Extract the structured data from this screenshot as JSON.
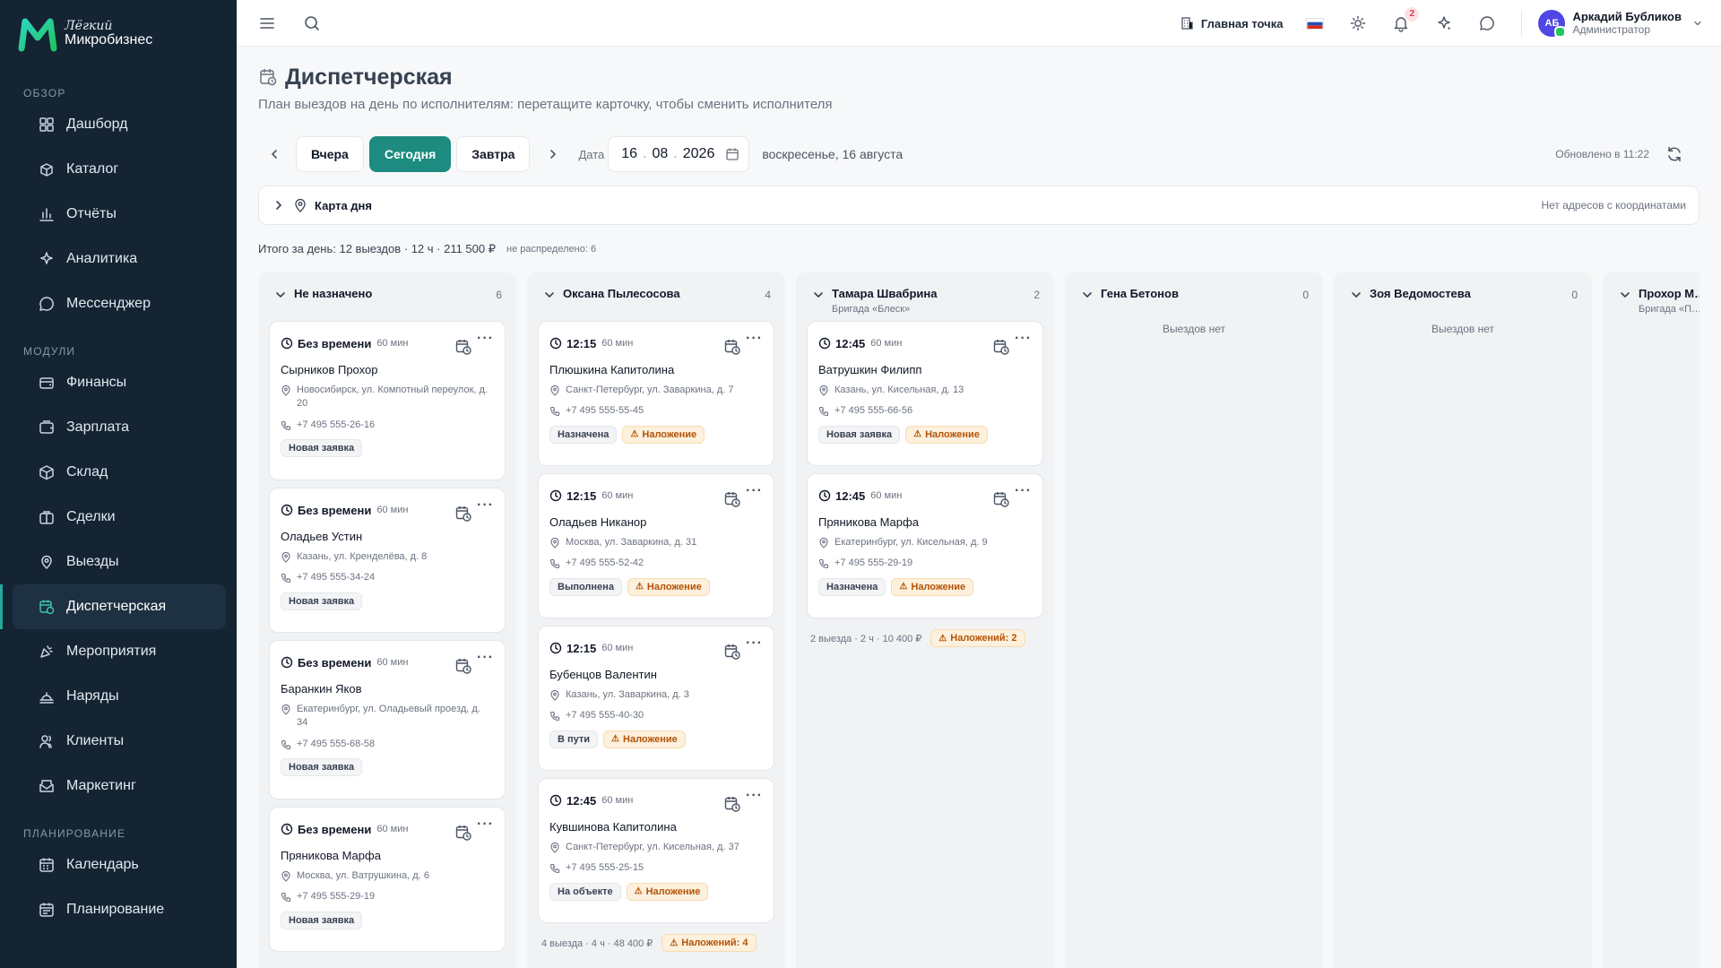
{
  "brand": {
    "light": "Лёгкий",
    "main": "Микробизнес"
  },
  "sidebar": {
    "sections": [
      {
        "title": "ОБЗОР",
        "items": [
          {
            "label": "Дашборд",
            "icon": "dashboard-icon"
          },
          {
            "label": "Каталог",
            "icon": "catalog-icon"
          },
          {
            "label": "Отчёты",
            "icon": "reports-icon"
          },
          {
            "label": "Аналитика",
            "icon": "analytics-icon"
          },
          {
            "label": "Мессенджер",
            "icon": "messenger-icon"
          }
        ]
      },
      {
        "title": "МОДУЛИ",
        "items": [
          {
            "label": "Финансы",
            "icon": "finance-icon"
          },
          {
            "label": "Зарплата",
            "icon": "salary-icon"
          },
          {
            "label": "Склад",
            "icon": "warehouse-icon"
          },
          {
            "label": "Сделки",
            "icon": "deals-icon"
          },
          {
            "label": "Выезды",
            "icon": "visits-icon"
          },
          {
            "label": "Диспетчерская",
            "icon": "dispatch-icon",
            "active": true
          },
          {
            "label": "Мероприятия",
            "icon": "events-icon"
          },
          {
            "label": "Наряды",
            "icon": "orders-icon"
          },
          {
            "label": "Клиенты",
            "icon": "clients-icon"
          },
          {
            "label": "Маркетинг",
            "icon": "marketing-icon"
          }
        ]
      },
      {
        "title": "ПЛАНИРОВАНИЕ",
        "items": [
          {
            "label": "Календарь",
            "icon": "calendar-icon"
          },
          {
            "label": "Планирование",
            "icon": "planning-icon"
          }
        ]
      }
    ]
  },
  "topbar": {
    "branch": "Главная точка",
    "notifications_count": "2",
    "user": {
      "initials": "АБ",
      "name": "Аркадий Бубликов",
      "role": "Администратор"
    }
  },
  "page": {
    "title": "Диспетчерская",
    "subtitle": "План выездов на день по исполнителям: перетащите карточку, чтобы сменить исполнителя"
  },
  "toolbar": {
    "yesterday": "Вчера",
    "today": "Сегодня",
    "tomorrow": "Завтра",
    "date_label": "Дата",
    "date_day": "16",
    "date_month": "08",
    "date_year": "2026",
    "date_human": "воскресенье, 16 августа",
    "updated": "Обновлено в 11:22"
  },
  "map": {
    "title": "Карта дня",
    "note": "Нет адресов с координатами"
  },
  "summary": {
    "total": "Итого за день: 12 выездов · 12 ч · 211 500 ₽",
    "unassigned": "не распределено: 6"
  },
  "columns": [
    {
      "name": "Не назначено",
      "sub": "",
      "count": "6",
      "empty": "",
      "footer": "",
      "footer_warn": "",
      "cards": [
        {
          "time": "Без времени",
          "dur": "60 мин",
          "name": "Сырников Прохор",
          "address": "Новосибирск, ул. Компотный переулок, д. 20",
          "phone": "+7 495 555-26-16",
          "tags": [
            {
              "text": "Новая заявка",
              "warn": false
            }
          ]
        },
        {
          "time": "Без времени",
          "dur": "60 мин",
          "name": "Оладьев Устин",
          "address": "Казань, ул. Кренделёва, д. 8",
          "phone": "+7 495 555-34-24",
          "tags": [
            {
              "text": "Новая заявка",
              "warn": false
            }
          ]
        },
        {
          "time": "Без времени",
          "dur": "60 мин",
          "name": "Баранкин Яков",
          "address": "Екатеринбург, ул. Оладьевый проезд, д. 34",
          "phone": "+7 495 555-68-58",
          "tags": [
            {
              "text": "Новая заявка",
              "warn": false
            }
          ]
        },
        {
          "time": "Без времени",
          "dur": "60 мин",
          "name": "Пряникова Марфа",
          "address": "Москва, ул. Ватрушкина, д. 6",
          "phone": "+7 495 555-29-19",
          "tags": [
            {
              "text": "Новая заявка",
              "warn": false
            }
          ]
        }
      ]
    },
    {
      "name": "Оксана Пылесосова",
      "sub": "",
      "count": "4",
      "empty": "",
      "footer": "4 выезда · 4 ч · 48 400 ₽",
      "footer_warn": "Наложений: 4",
      "cards": [
        {
          "time": "12:15",
          "dur": "60 мин",
          "name": "Плюшкина Капитолина",
          "address": "Санкт-Петербург, ул. Заваркина, д. 7",
          "phone": "+7 495 555-55-45",
          "tags": [
            {
              "text": "Назначена",
              "warn": false
            },
            {
              "text": "Наложение",
              "warn": true
            }
          ]
        },
        {
          "time": "12:15",
          "dur": "60 мин",
          "name": "Оладьев Никанор",
          "address": "Москва, ул. Заваркина, д. 31",
          "phone": "+7 495 555-52-42",
          "tags": [
            {
              "text": "Выполнена",
              "warn": false
            },
            {
              "text": "Наложение",
              "warn": true
            }
          ]
        },
        {
          "time": "12:15",
          "dur": "60 мин",
          "name": "Бубенцов Валентин",
          "address": "Казань, ул. Заваркина, д. 3",
          "phone": "+7 495 555-40-30",
          "tags": [
            {
              "text": "В пути",
              "warn": false
            },
            {
              "text": "Наложение",
              "warn": true
            }
          ]
        },
        {
          "time": "12:45",
          "dur": "60 мин",
          "name": "Кувшинова Капитолина",
          "address": "Санкт-Петербург, ул. Кисельная, д. 37",
          "phone": "+7 495 555-25-15",
          "tags": [
            {
              "text": "На объекте",
              "warn": false
            },
            {
              "text": "Наложение",
              "warn": true
            }
          ]
        }
      ]
    },
    {
      "name": "Тамара Швабрина",
      "sub": "Бригада «Блеск»",
      "count": "2",
      "empty": "",
      "footer": "2 выезда · 2 ч · 10 400 ₽",
      "footer_warn": "Наложений: 2",
      "cards": [
        {
          "time": "12:45",
          "dur": "60 мин",
          "name": "Ватрушкин Филипп",
          "address": "Казань, ул. Кисельная, д. 13",
          "phone": "+7 495 555-66-56",
          "tags": [
            {
              "text": "Новая заявка",
              "warn": false
            },
            {
              "text": "Наложение",
              "warn": true
            }
          ]
        },
        {
          "time": "12:45",
          "dur": "60 мин",
          "name": "Пряникова Марфа",
          "address": "Екатеринбург, ул. Кисельная, д. 9",
          "phone": "+7 495 555-29-19",
          "tags": [
            {
              "text": "Назначена",
              "warn": false
            },
            {
              "text": "Наложение",
              "warn": true
            }
          ]
        }
      ]
    },
    {
      "name": "Гена Бетонов",
      "sub": "",
      "count": "0",
      "empty": "Выездов нет",
      "footer": "",
      "footer_warn": "",
      "cards": []
    },
    {
      "name": "Зоя Ведомостева",
      "sub": "",
      "count": "0",
      "empty": "Выездов нет",
      "footer": "",
      "footer_warn": "",
      "cards": []
    },
    {
      "name": "Прохор М…",
      "sub": "Бригада «П…",
      "count": "",
      "empty": "",
      "footer": "",
      "footer_warn": "",
      "cards": []
    }
  ]
}
